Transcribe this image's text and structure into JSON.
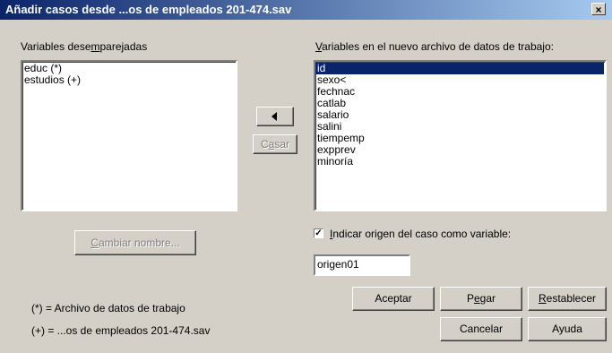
{
  "window": {
    "title": "Añadir casos desde ...os de empleados 201-474.sav",
    "close_glyph": "×"
  },
  "unpaired": {
    "label_pre": "Variables dese",
    "label_ul": "m",
    "label_post": "parejadas",
    "items": [
      "educ (*)",
      "estudios (+)"
    ]
  },
  "new_file": {
    "label_ul": "V",
    "label_post": "ariables en el nuevo archivo de datos de trabajo:",
    "items": [
      "id",
      "sexo<",
      "fechnac",
      "catlab",
      "salario",
      "salini",
      "tiempemp",
      "expprev",
      "minoría"
    ],
    "selected": "id"
  },
  "buttons": {
    "move_left_icon": "arrow-left-icon",
    "pair_ul": "P",
    "pair_post": "a",
    "pair_pre": "C",
    "pair_rest": "ar",
    "rename_ul": "C",
    "rename_post": "ambiar nombre...",
    "accept": "Aceptar",
    "paste_pre": "P",
    "paste_ul": "e",
    "paste_post": "gar",
    "reset_ul": "R",
    "reset_post": "establecer",
    "cancel": "Cancelar",
    "help": "Ayuda"
  },
  "indicator": {
    "checked": true,
    "check_glyph": "✓",
    "label_ul": "I",
    "label_post": "ndicar origen del caso como variable:",
    "value": "origen01"
  },
  "legend": {
    "working": "(*) = Archivo de datos de trabajo",
    "other": "(+) = ...os de empleados 201-474.sav"
  },
  "colors": {
    "titlebar": "#0a246a",
    "selection": "#0a246a",
    "face": "#d4d0c8"
  }
}
